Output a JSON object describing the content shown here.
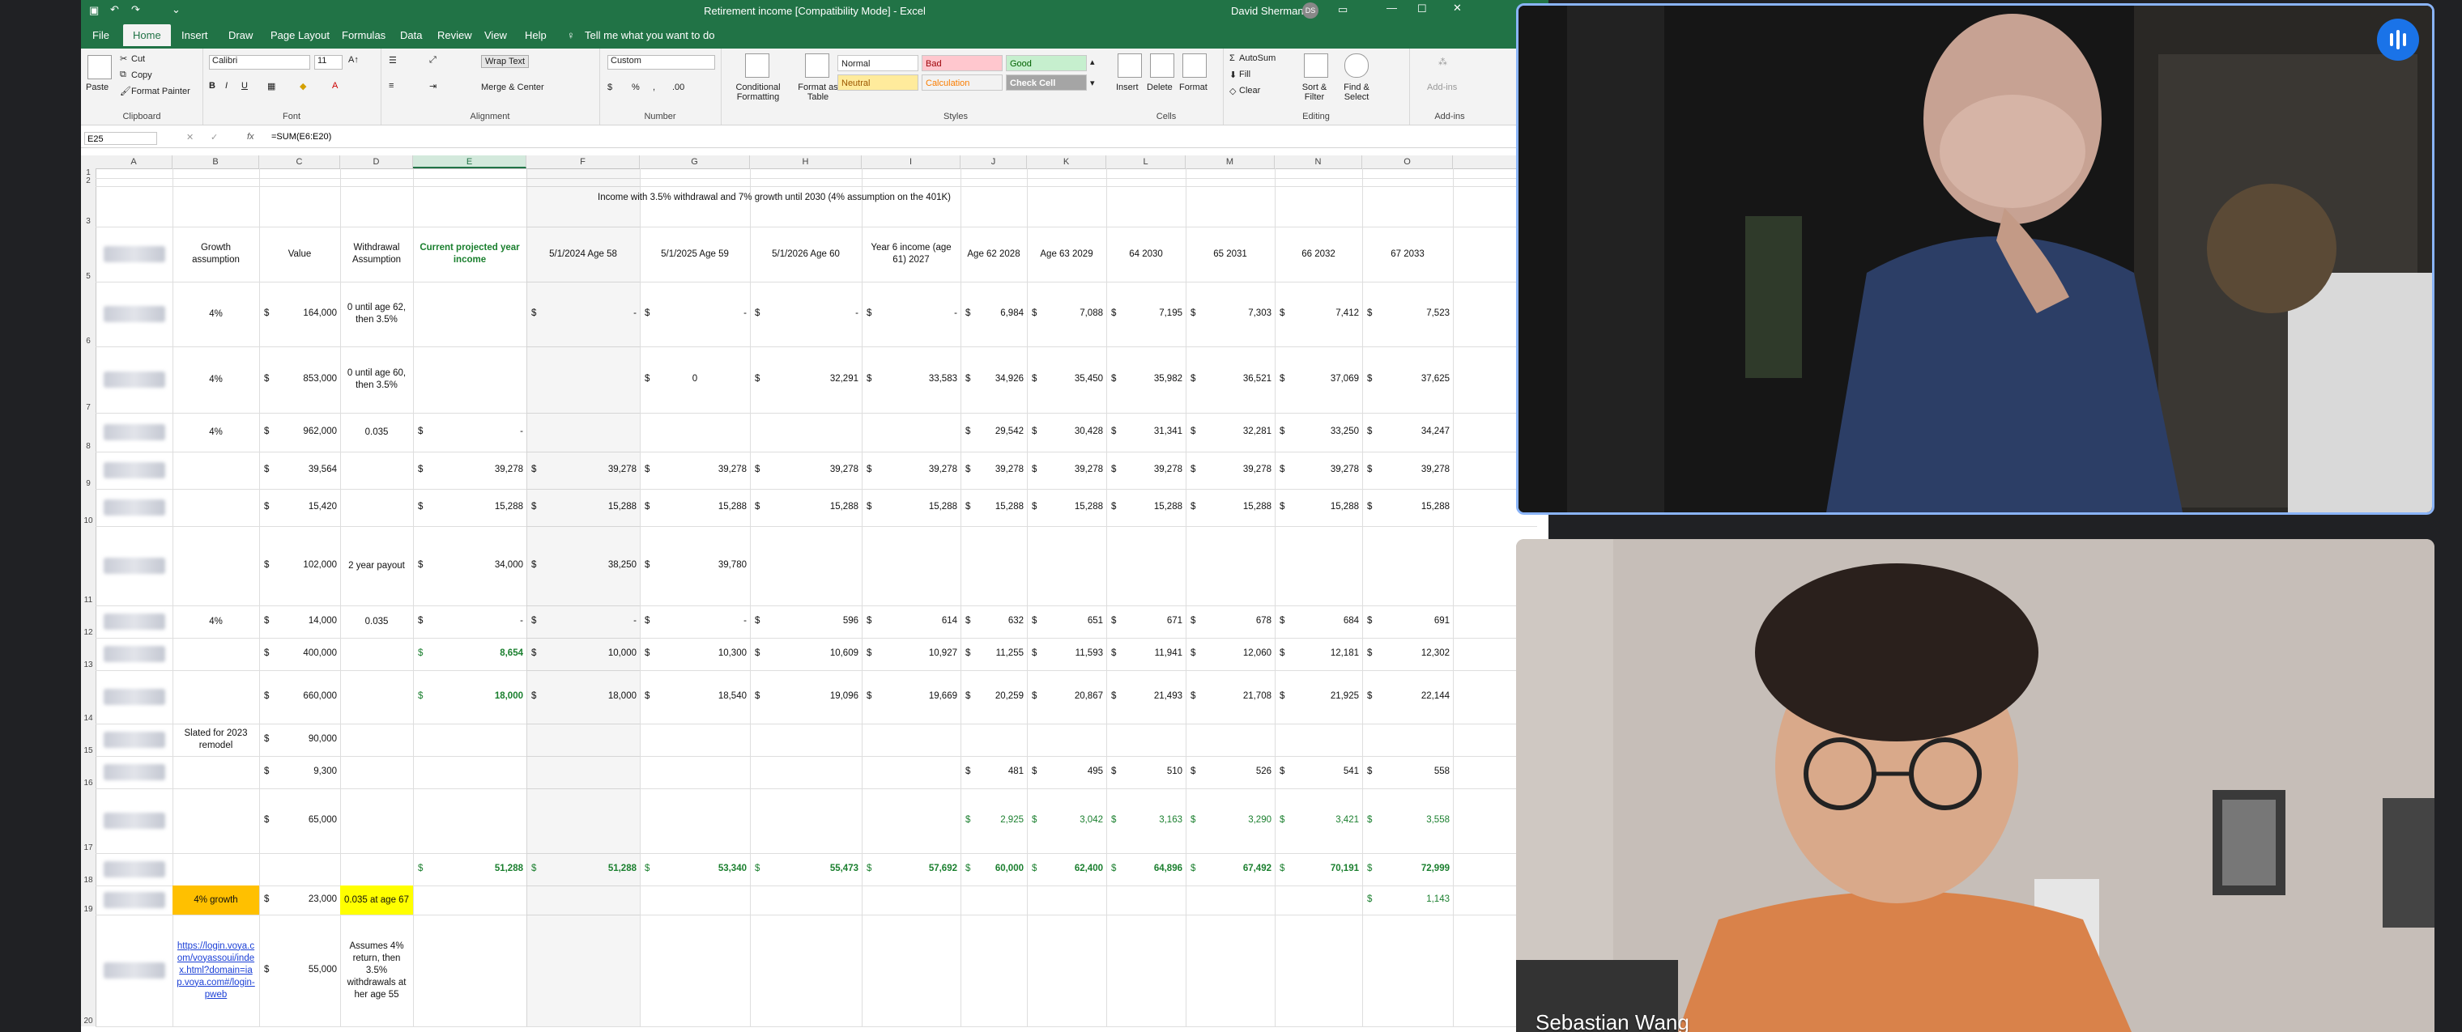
{
  "excel": {
    "window_title": "Retirement income [Compatibility Mode] - Excel",
    "user_name": "David Sherman",
    "user_initials": "DS",
    "menu": [
      "File",
      "Home",
      "Insert",
      "Draw",
      "Page Layout",
      "Formulas",
      "Data",
      "Review",
      "View",
      "Help"
    ],
    "tell_me": "Tell me what you want to do",
    "ribbon": {
      "clipboard": {
        "paste": "Paste",
        "cut": "Cut",
        "copy": "Copy",
        "format_painter": "Format Painter",
        "label": "Clipboard"
      },
      "font": {
        "name": "Calibri",
        "size": "11",
        "label": "Font"
      },
      "alignment": {
        "wrap_text": "Wrap Text",
        "merge_center": "Merge & Center",
        "label": "Alignment"
      },
      "number": {
        "format": "Custom",
        "label": "Number"
      },
      "styles": {
        "conditional_formatting": "Conditional Formatting",
        "format_as_table": "Format as Table",
        "normal": "Normal",
        "bad": "Bad",
        "good": "Good",
        "neutral": "Neutral",
        "calculation": "Calculation",
        "check_cell": "Check Cell",
        "label": "Styles"
      },
      "cells": {
        "insert": "Insert",
        "delete": "Delete",
        "format": "Format",
        "label": "Cells"
      },
      "editing": {
        "autosum": "AutoSum",
        "fill": "Fill",
        "clear": "Clear",
        "sort_filter": "Sort & Filter",
        "find_select": "Find & Select",
        "label": "Editing"
      },
      "addins": {
        "addins": "Add-ins",
        "label": "Add-ins"
      }
    },
    "name_box": "E25",
    "formula": "=SUM(E6:E20)",
    "columns": [
      "A",
      "B",
      "C",
      "D",
      "E",
      "F",
      "G",
      "H",
      "I",
      "J",
      "K",
      "L",
      "M",
      "N",
      "O"
    ],
    "selected_column": "E",
    "rows": [
      "1",
      "2",
      "3",
      "5",
      "6",
      "7",
      "8",
      "9",
      "10",
      "11",
      "12",
      "13",
      "14",
      "15",
      "16",
      "17",
      "18",
      "19",
      "20"
    ],
    "sheet_title": "Income with 3.5% withdrawal and 7% growth until 2030 (4% assumption on the 401K)",
    "headers": {
      "b": "Growth assumption",
      "c": "Value",
      "d": "Withdrawal Assumption",
      "e": "Current projected year income",
      "f": "5/1/2024 Age 58",
      "g": "5/1/2025 Age 59",
      "h": "5/1/2026 Age 60",
      "i": "Year 6 income (age 61) 2027",
      "j": "Age 62 2028",
      "k": "Age 63 2029",
      "l": "64 2030",
      "m": "65 2031",
      "n": "66 2032",
      "o": "67 2033"
    },
    "cells": {
      "r6": {
        "b": "4%",
        "c": "164,000",
        "d": "0 until age 62, then 3.5%",
        "f": "-",
        "g": "-",
        "h": "-",
        "i": "-",
        "j": "6,984",
        "k": "7,088",
        "l": "7,195",
        "m": "7,303",
        "n": "7,412",
        "o": "7,523"
      },
      "r7": {
        "b": "4%",
        "c": "853,000",
        "d": "0 until age 60, then 3.5%",
        "g": "0",
        "h": "32,291",
        "i": "33,583",
        "j": "34,926",
        "k": "35,450",
        "l": "35,982",
        "m": "36,521",
        "n": "37,069",
        "o": "37,625"
      },
      "r8": {
        "b": "4%",
        "c": "962,000",
        "d": "0.035",
        "e": "-",
        "j": "29,542",
        "k": "30,428",
        "l": "31,341",
        "m": "32,281",
        "n": "33,250",
        "o": "34,247"
      },
      "r9": {
        "c": "39,564",
        "e": "39,278",
        "f": "39,278",
        "g": "39,278",
        "h": "39,278",
        "i": "39,278",
        "j": "39,278",
        "k": "39,278",
        "l": "39,278",
        "m": "39,278",
        "n": "39,278",
        "o": "39,278"
      },
      "r10": {
        "c": "15,420",
        "e": "15,288",
        "f": "15,288",
        "g": "15,288",
        "h": "15,288",
        "i": "15,288",
        "j": "15,288",
        "k": "15,288",
        "l": "15,288",
        "m": "15,288",
        "n": "15,288",
        "o": "15,288"
      },
      "r11": {
        "c": "102,000",
        "d": "2 year payout",
        "e": "34,000",
        "f": "38,250",
        "g": "39,780"
      },
      "r12": {
        "b": "4%",
        "c": "14,000",
        "d": "0.035",
        "e": "-",
        "f": "-",
        "g": "-",
        "h": "596",
        "i": "614",
        "j": "632",
        "k": "651",
        "l": "671",
        "m": "678",
        "n": "684",
        "o": "691"
      },
      "r13": {
        "c": "400,000",
        "e": "8,654",
        "f": "10,000",
        "g": "10,300",
        "h": "10,609",
        "i": "10,927",
        "j": "11,255",
        "k": "11,593",
        "l": "11,941",
        "m": "12,060",
        "n": "12,181",
        "o": "12,302"
      },
      "r14": {
        "c": "660,000",
        "e": "18,000",
        "f": "18,000",
        "g": "18,540",
        "h": "19,096",
        "i": "19,669",
        "j": "20,259",
        "k": "20,867",
        "l": "21,493",
        "m": "21,708",
        "n": "21,925",
        "o": "22,144"
      },
      "r15": {
        "b": "Slated for 2023 remodel",
        "c": "90,000"
      },
      "r16": {
        "c": "9,300",
        "j": "481",
        "k": "495",
        "l": "510",
        "m": "526",
        "n": "541",
        "o": "558"
      },
      "r17": {
        "c": "65,000",
        "j": "2,925",
        "k": "3,042",
        "l": "3,163",
        "m": "3,290",
        "n": "3,421",
        "o": "3,558"
      },
      "r18": {
        "e": "51,288",
        "f": "51,288",
        "g": "53,340",
        "h": "55,473",
        "i": "57,692",
        "j": "60,000",
        "k": "62,400",
        "l": "64,896",
        "m": "67,492",
        "n": "70,191",
        "o": "72,999"
      },
      "r19": {
        "b": "4% growth",
        "c": "23,000",
        "d": "0.035 at age 67",
        "o": "1,143"
      },
      "r20": {
        "b": "https://login.voya.com/voyassoui/index.html?domain=iap.voya.com#/login-pweb",
        "c": "55,000",
        "d": "Assumes 4% return, then 3.5% withdrawals at her age 55"
      }
    },
    "dollar": "$"
  },
  "meeting": {
    "participant_1": {
      "name": ""
    },
    "participant_2": {
      "name": "Sebastian Wang"
    }
  },
  "colors": {
    "excel_green": "#217346",
    "accent_blue": "#8ab4f8",
    "speaker_blue": "#1a73e8",
    "highlight_orange": "#ffc000",
    "highlight_yellow": "#ffff00"
  }
}
